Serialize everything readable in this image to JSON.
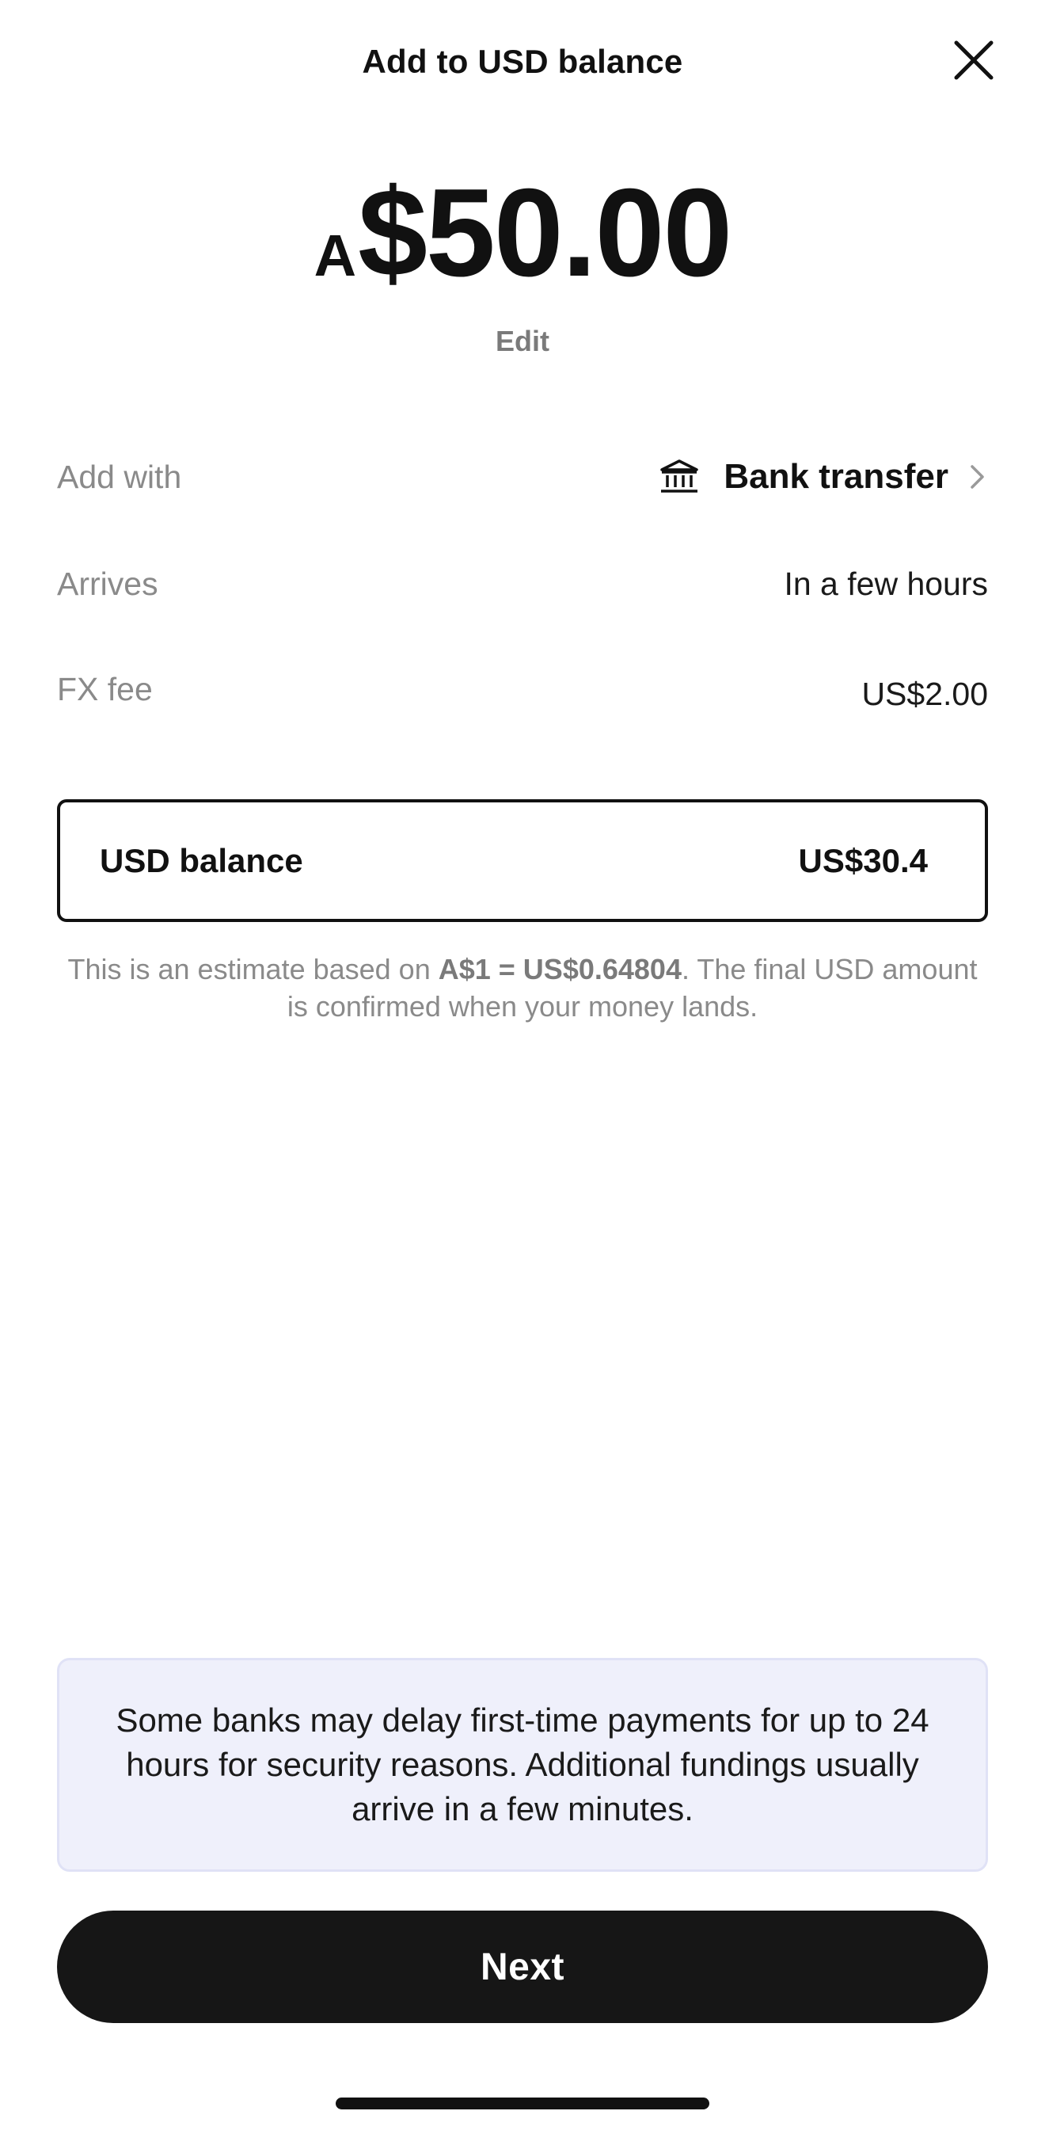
{
  "header": {
    "title": "Add to USD balance",
    "close_icon": "close-icon"
  },
  "amount": {
    "prefix": "A",
    "value": "$50.00",
    "edit_label": "Edit"
  },
  "details": {
    "add_with": {
      "label": "Add with",
      "icon": "bank-icon",
      "value": "Bank transfer",
      "chevron_icon": "chevron-right-icon"
    },
    "arrives": {
      "label": "Arrives",
      "value": "In a few hours"
    },
    "fx_fee": {
      "label": "FX fee",
      "value": "US$2.00"
    }
  },
  "balance": {
    "label": "USD balance",
    "value": "US$30.4"
  },
  "estimate": {
    "prefix": "This is an estimate based on ",
    "rate": "A$1 = US$0.64804",
    "suffix": ". The final USD amount is confirmed when your money lands."
  },
  "notice": {
    "text": "Some banks may delay first-time payments for up to 24 hours for security reasons. Additional fundings usually arrive in a few minutes."
  },
  "footer": {
    "next_label": "Next"
  },
  "colors": {
    "primary_button": "#161616",
    "notice_background": "#eff0fb",
    "muted_text": "#8a8a8a"
  }
}
